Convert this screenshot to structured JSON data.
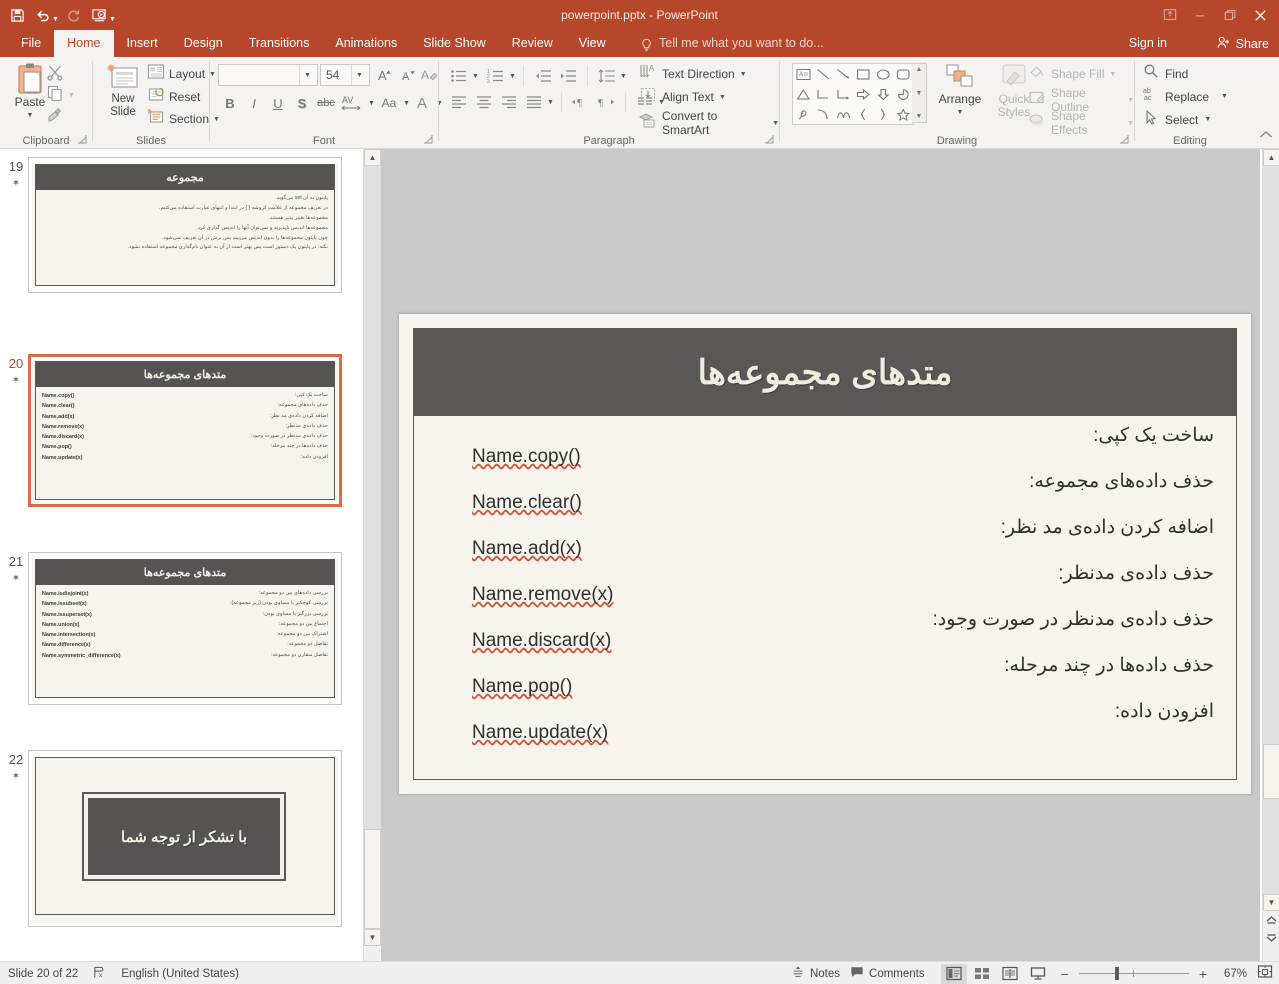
{
  "window": {
    "title": "powerpoint.pptx - PowerPoint",
    "quick_access": [
      {
        "name": "save-icon",
        "label": "Save"
      },
      {
        "name": "undo-icon",
        "label": "Undo"
      },
      {
        "name": "redo-icon",
        "label": "Redo"
      },
      {
        "name": "start-presentation-icon",
        "label": "Start From Beginning"
      },
      {
        "name": "customize-qat-icon",
        "label": "Customize Quick Access Toolbar"
      }
    ],
    "controls": [
      {
        "name": "ribbon-display-options-icon",
        "glyph": "⬆"
      },
      {
        "name": "minimize-icon",
        "glyph": "—"
      },
      {
        "name": "restore-icon",
        "glyph": "❐"
      },
      {
        "name": "close-icon",
        "glyph": "✕"
      }
    ]
  },
  "tabs": [
    {
      "label": "File",
      "active": false
    },
    {
      "label": "Home",
      "active": true
    },
    {
      "label": "Insert",
      "active": false
    },
    {
      "label": "Design",
      "active": false
    },
    {
      "label": "Transitions",
      "active": false
    },
    {
      "label": "Animations",
      "active": false
    },
    {
      "label": "Slide Show",
      "active": false
    },
    {
      "label": "Review",
      "active": false
    },
    {
      "label": "View",
      "active": false
    }
  ],
  "tellme": {
    "label": "Tell me what you want to do...",
    "icon": "lightbulb-icon"
  },
  "account": {
    "signin": "Sign in",
    "share": "Share",
    "share_icon": "person-add-icon"
  },
  "ribbon": {
    "clipboard": {
      "group_label": "Clipboard",
      "paste_label": "Paste",
      "cut_label": "Cut",
      "copy_label": "Copy",
      "format_painter_label": "Format Painter"
    },
    "slides": {
      "group_label": "Slides",
      "new_slide_label": "New\nSlide",
      "new_slide_line1": "New",
      "new_slide_line2": "Slide",
      "layout_label": "Layout",
      "reset_label": "Reset",
      "section_label": "Section"
    },
    "font": {
      "group_label": "Font",
      "font_name_value": "",
      "font_name_placeholder": "",
      "font_size_value": "54",
      "grow_font_label": "A",
      "shrink_font_label": "A",
      "clear_formatting_label": "Clear All Formatting",
      "bold_label": "B",
      "italic_label": "I",
      "underline_label": "U",
      "shadow_label": "S",
      "strikethrough_label": "abc",
      "char_spacing_label": "AV",
      "change_case_label": "Aa",
      "font_color_label": "A"
    },
    "paragraph": {
      "group_label": "Paragraph",
      "bullets_label": "Bullets",
      "numbering_label": "Numbering",
      "decrease_indent_label": "Decrease List Level",
      "increase_indent_label": "Increase List Level",
      "line_spacing_label": "Line Spacing",
      "align_left_label": "Align Left",
      "center_label": "Center",
      "align_right_label": "Align Right",
      "justify_label": "Justify",
      "ltr_label": "Left-to-Right",
      "rtl_label": "Right-to-Left",
      "columns_label": "Columns",
      "text_direction_label": "Text Direction",
      "align_text_label": "Align Text",
      "convert_smartart_label": "Convert to SmartArt"
    },
    "drawing": {
      "group_label": "Drawing",
      "arrange_label": "Arrange",
      "quick_styles_line1": "Quick",
      "quick_styles_line2": "Styles",
      "shape_fill_label": "Shape Fill",
      "shape_outline_label": "Shape Outline",
      "shape_effects_label": "Shape Effects"
    },
    "editing": {
      "group_label": "Editing",
      "find_label": "Find",
      "replace_label": "Replace",
      "select_label": "Select"
    },
    "collapse_ribbon_icon": "chevron-up-icon"
  },
  "thumbnails": [
    {
      "number": "19",
      "selected": false,
      "title": "مجموعه",
      "lines": [
        "پایتون به آن set می‌گوید.",
        "در تعریف مجموعه از علامت کروشه { }  در ابتدا و انتهای عبارت استفاده می‌کنیم.",
        "مجموعه‌ها تغییر پذیر هستند.",
        "مجموعه‌ها اندیس ناپذیرند و نمی‌توان آنها را اندیس گذاری کرد.",
        "چون پایتون مجموعه‌ها را بدون اندیس می‌بیند پس برش در آن تعریف نمی‌شود.",
        "نکته: در پایتون  یک دستور است پس بهتر است از آن به عنوان نام‌گذاری مجموعه استفاده نشود."
      ],
      "pairs": []
    },
    {
      "number": "20",
      "selected": true,
      "title": "متدهای مجموعه‌ها",
      "lines": [],
      "pairs": [
        {
          "code": "Name.copy()",
          "text": "ساخت یک کپی:"
        },
        {
          "code": "Name.clear()",
          "text": "حذف داده‌های مجموعه:"
        },
        {
          "code": "Name.add(x)",
          "text": "اضافه کردن داده‌ی مد نظر:"
        },
        {
          "code": "Name.remove(x)",
          "text": "حذف داده‌ی مدنظر:"
        },
        {
          "code": "Name.discard(x)",
          "text": "حذف داده‌ی مدنظر در صورت وجود:"
        },
        {
          "code": "Name.pop()",
          "text": "حذف داده‌ها در چند مرحله:"
        },
        {
          "code": "Name.update(x)",
          "text": "افزودن داده:"
        }
      ]
    },
    {
      "number": "21",
      "selected": false,
      "title": "متدهای مجموعه‌ها",
      "lines": [],
      "pairs": [
        {
          "code": "Name.isdisjoint(x)",
          "text": "بررسی داده‌های بین دو مجموعه:"
        },
        {
          "code": "Name.issubset(x)",
          "text": "بررسی کوچکتر یا مساوی بودن (زیر مجموعه):"
        },
        {
          "code": "Name.issuperset(x)",
          "text": "بررسی بزرگتر یا مساوی بودن:"
        },
        {
          "code": "Name.union(x)",
          "text": "اجتماع بین دو مجموعه:"
        },
        {
          "code": "Name.intersection(x)",
          "text": "اشتراک بین دو مجموعه:"
        },
        {
          "code": "Name.difference(x)",
          "text": "تفاضل دو مجموعه:"
        },
        {
          "code": "Name.symmetric_difference(x)",
          "text": "تفاضل متقارن دو مجموعه:"
        }
      ]
    },
    {
      "number": "22",
      "selected": false,
      "title": "",
      "closing_text": "با تشکر از توجه شما",
      "lines": [],
      "pairs": []
    }
  ],
  "slide": {
    "title": "متدهای مجموعه‌ها",
    "rows": [
      {
        "text": "ساخت یک کپی:",
        "code": "Name.copy()"
      },
      {
        "text": "حذف داده‌های مجموعه:",
        "code": "Name.clear()"
      },
      {
        "text": "اضافه کردن داده‌ی مد نظر:",
        "code": "Name.add(x)"
      },
      {
        "text": "حذف داده‌ی مدنظر:",
        "code": "Name.remove(x)"
      },
      {
        "text": "حذف داده‌ی مدنظر در صورت وجود:",
        "code": "Name.discard(x)"
      },
      {
        "text": "حذف داده‌ها در چند مرحله:",
        "code": "Name.pop()"
      },
      {
        "text": "افزودن داده:",
        "code": "Name.update(x)"
      }
    ]
  },
  "statusbar": {
    "slide_counter": "Slide 20 of 22",
    "language": "English (United States)",
    "spellcheck_icon": "spellcheck-icon",
    "notes_label": "Notes",
    "comments_label": "Comments",
    "views": [
      {
        "name": "normal-view-button",
        "active": true
      },
      {
        "name": "slide-sorter-button",
        "active": false
      },
      {
        "name": "reading-view-button",
        "active": false
      },
      {
        "name": "slideshow-button",
        "active": false
      }
    ],
    "zoom_out_label": "−",
    "zoom_in_label": "+",
    "zoom_value": "67%",
    "fit_slide_icon": "fit-to-window-icon"
  },
  "colors": {
    "accent": "#b7472a",
    "ribbon_bg": "#f5f3f1",
    "slide_bg": "#f7f4ee",
    "slide_header": "#595857",
    "selection": "#e06944",
    "squiggle": "#d0563a"
  }
}
